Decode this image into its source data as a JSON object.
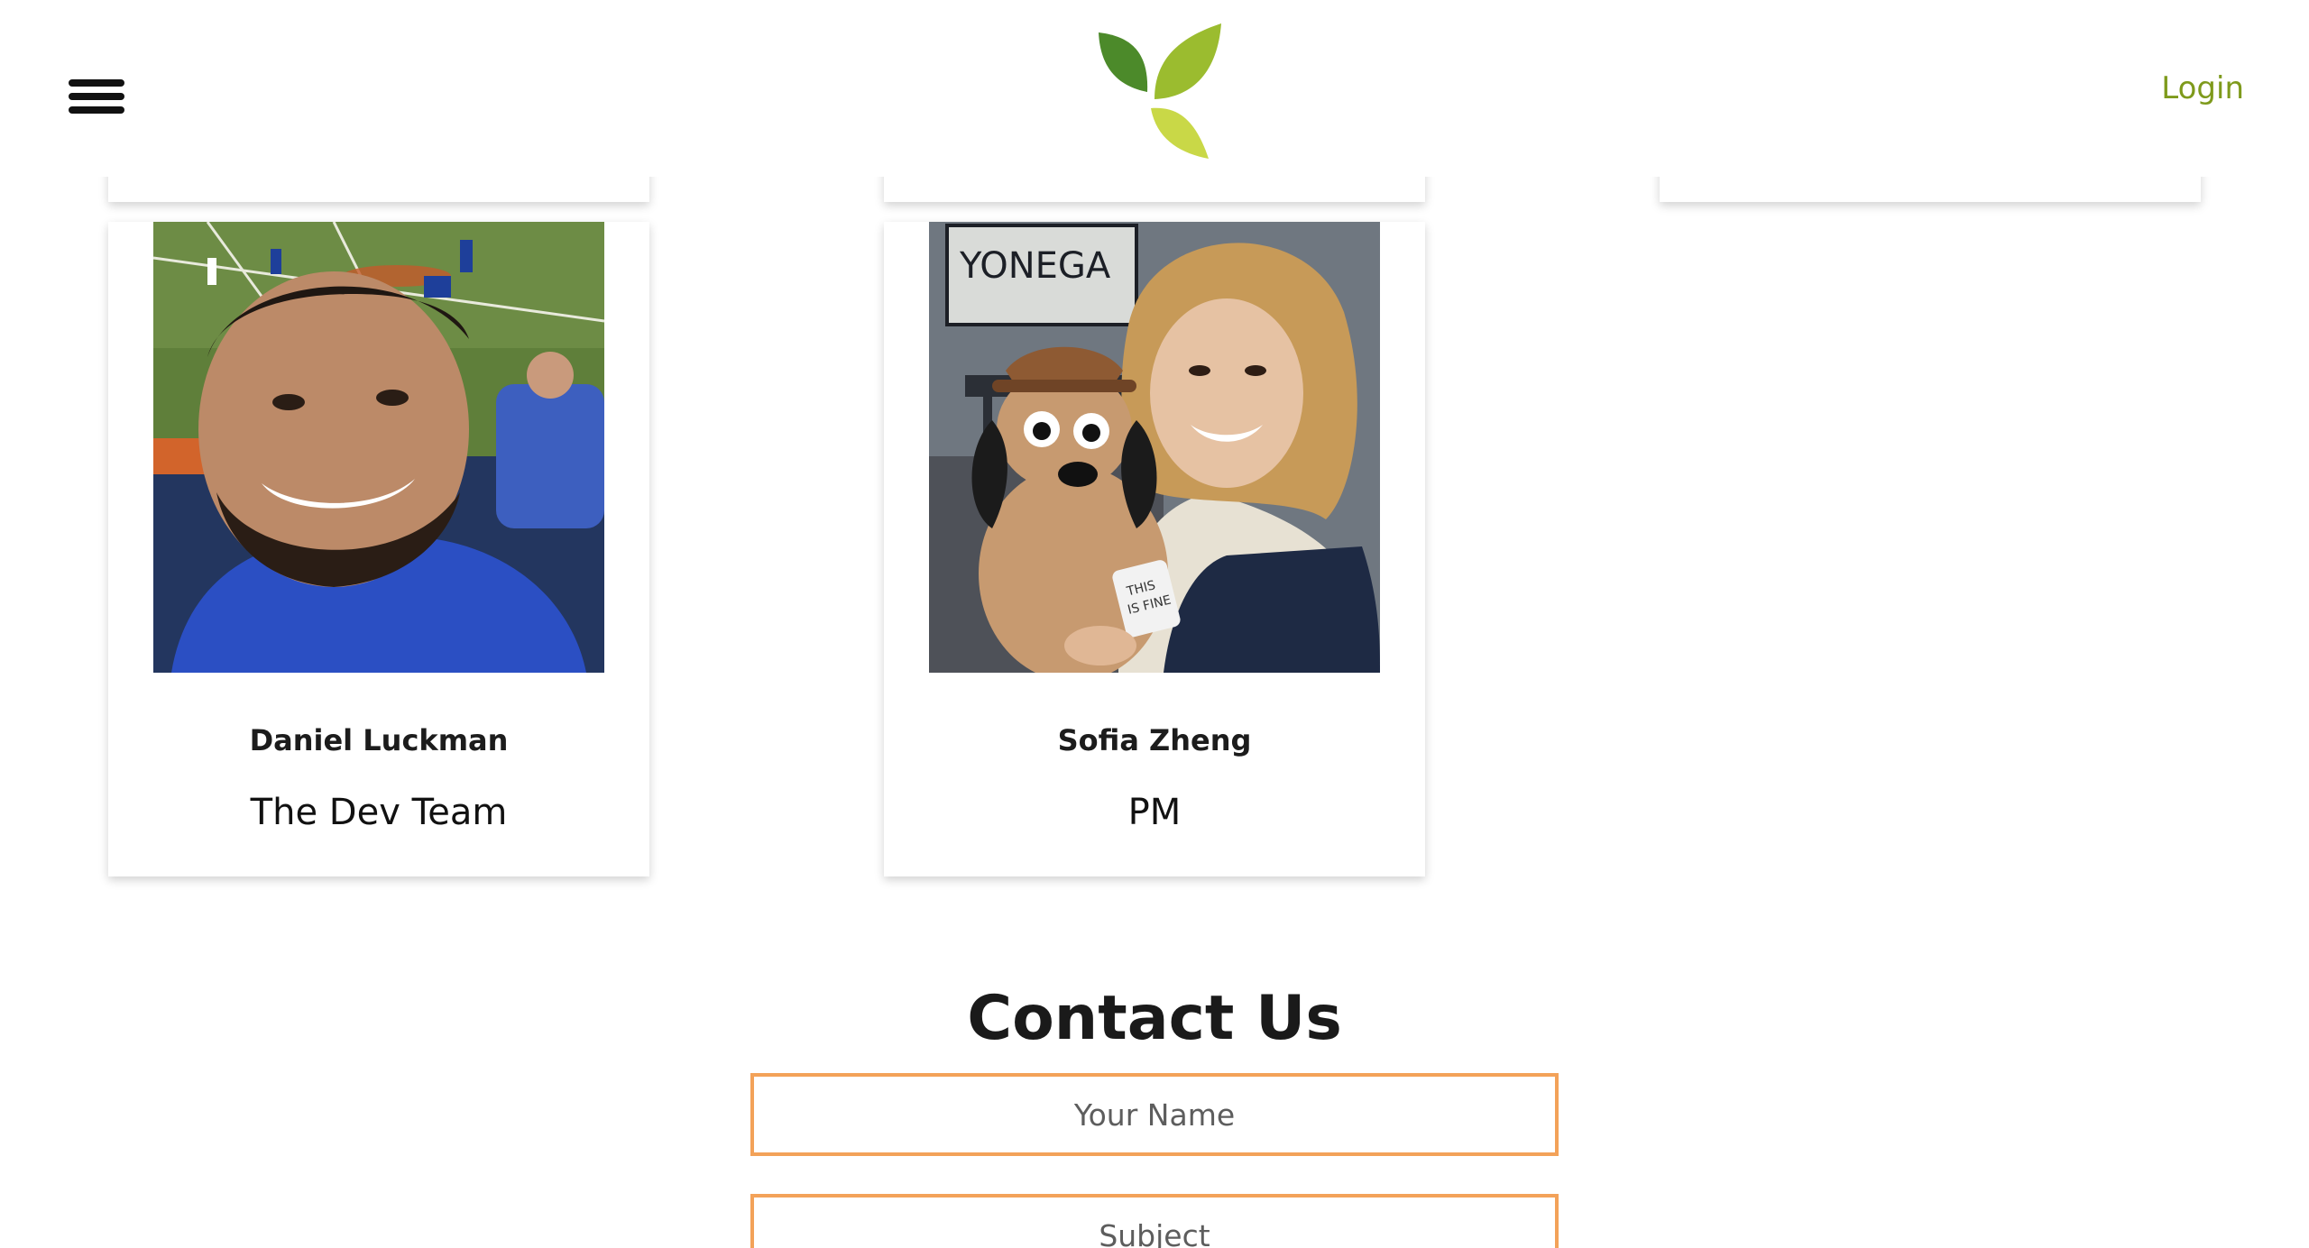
{
  "header": {
    "login_label": "Login"
  },
  "team": [
    {
      "name": "Daniel Luckman",
      "role": "The Dev Team"
    },
    {
      "name": "Sofia Zheng",
      "role": "PM"
    }
  ],
  "sofia_photo_text": {
    "sign": "YONEGA",
    "cup_line1": "THIS",
    "cup_line2": "IS FINE"
  },
  "contact": {
    "title": "Contact Us",
    "name_placeholder": "Your Name",
    "subject_placeholder": "Subject"
  },
  "colors": {
    "accent_login": "#7e9a1c",
    "input_border": "#f3a259",
    "top_accent": "#f0c8c4",
    "logo_dark_leaf": "#4c8a2a",
    "logo_mid_leaf": "#9bbc2f",
    "logo_light_leaf": "#c9d847"
  },
  "icons": {
    "menu": "hamburger-menu-icon",
    "logo": "leaf-logo"
  }
}
